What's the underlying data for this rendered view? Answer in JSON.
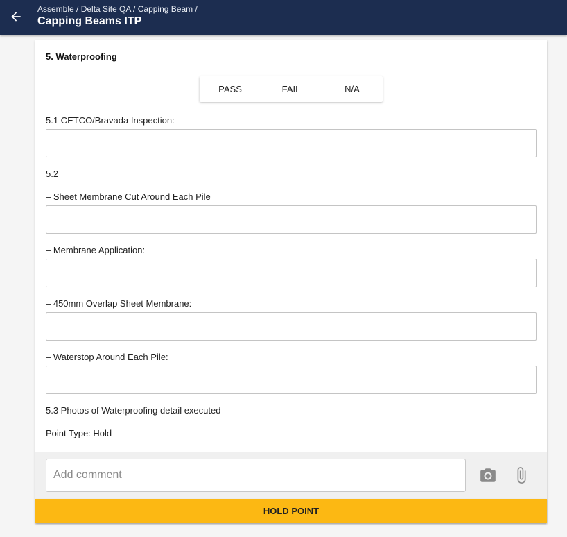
{
  "header": {
    "breadcrumb": "Assemble / Delta Site QA / Capping Beam /",
    "title": "Capping Beams ITP"
  },
  "section": {
    "title": "5. Waterproofing",
    "options": [
      "PASS",
      "FAIL",
      "N/A"
    ]
  },
  "items": [
    {
      "label": "5.1 CETCO/Bravada Inspection:",
      "value": ""
    },
    {
      "label": "5.2"
    },
    {
      "label": "– Sheet Membrane Cut Around Each Pile",
      "value": ""
    },
    {
      "label": "– Membrane Application:",
      "value": ""
    },
    {
      "label": "– 450mm Overlap Sheet Membrane:",
      "value": ""
    },
    {
      "label": "– Waterstop Around Each Pile:",
      "value": ""
    },
    {
      "label": "5.3 Photos of Waterproofing detail executed"
    },
    {
      "label": "Point Type: Hold"
    }
  ],
  "comment": {
    "placeholder": "Add comment",
    "value": "",
    "icons": [
      "camera-icon",
      "paperclip-icon"
    ]
  },
  "action": {
    "label": "HOLD POINT",
    "color": "#fcb813"
  },
  "colors": {
    "header_bg": "#1c2d50",
    "page_bg": "#f5f5f5"
  }
}
